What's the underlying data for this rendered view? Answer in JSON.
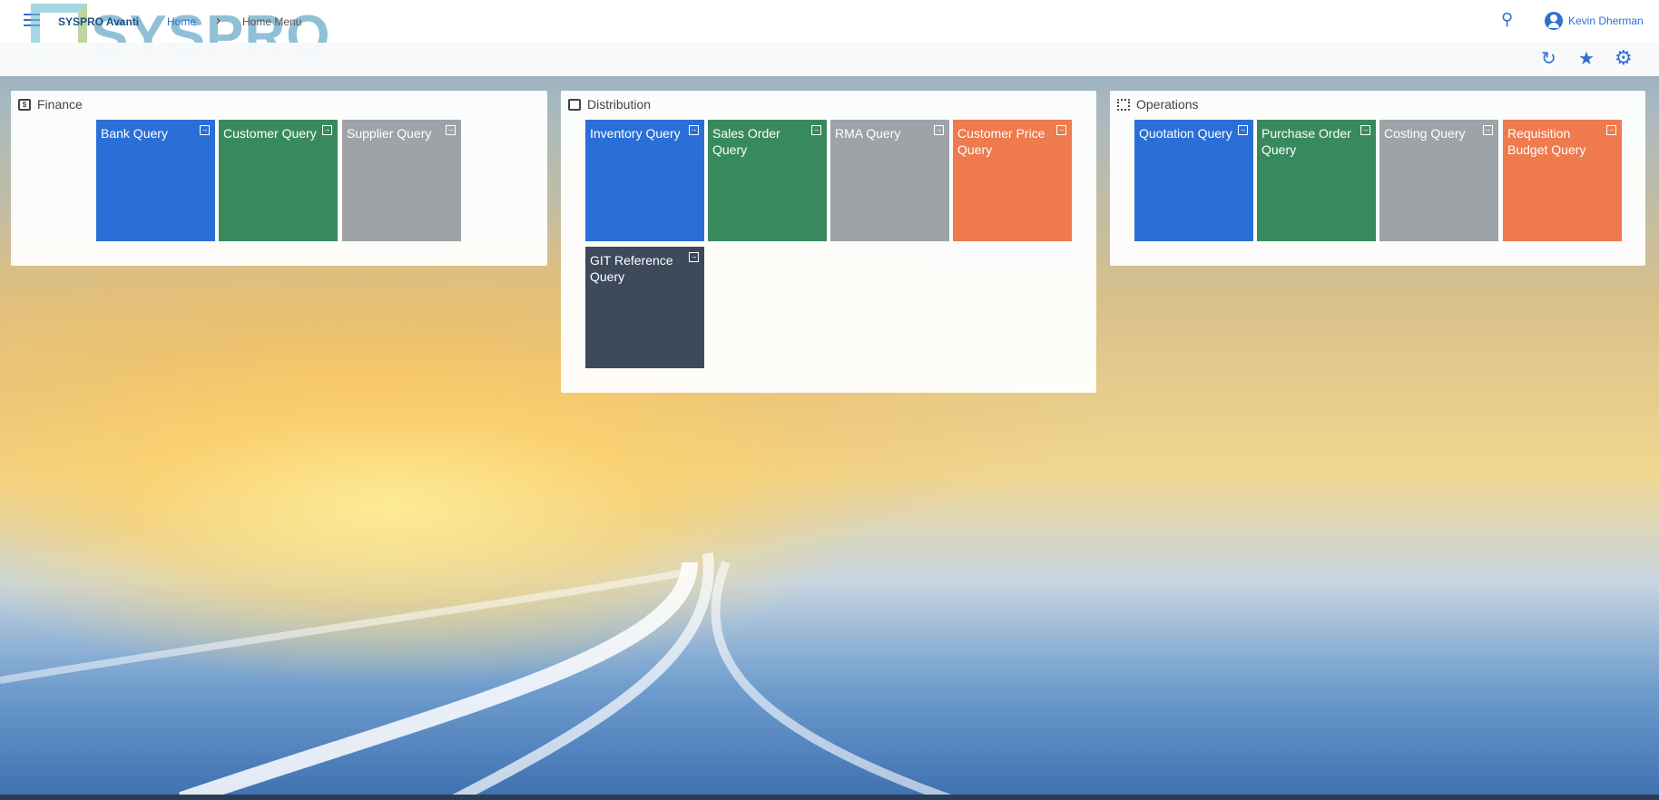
{
  "header": {
    "brand": "SYSPRO Avanti",
    "logo_text": "SYSPRO",
    "breadcrumb": [
      "Home",
      "Home Menu"
    ],
    "user": "Kevin Dherman"
  },
  "toolbar": {
    "icons": [
      "refresh-icon",
      "star-icon",
      "gear-icon"
    ]
  },
  "colors": {
    "blue": "#2a6fd8",
    "green": "#388a5e",
    "gray": "#9ea3a8",
    "orange": "#ee7a4e",
    "dark": "#3d4a5c",
    "accent": "#2f6fd0"
  },
  "panels": [
    {
      "title": "Finance",
      "tiles": [
        {
          "label": "Bank Query",
          "color": "blue"
        },
        {
          "label": "Customer Query",
          "color": "green"
        },
        {
          "label": "Supplier Query",
          "color": "gray"
        }
      ]
    },
    {
      "title": "Distribution",
      "tiles": [
        {
          "label": "Inventory Query",
          "color": "blue"
        },
        {
          "label": "Sales Order Query",
          "color": "green"
        },
        {
          "label": "RMA Query",
          "color": "gray"
        },
        {
          "label": "Customer Price Query",
          "color": "orange"
        },
        {
          "label": "GIT Reference Query",
          "color": "dark"
        }
      ]
    },
    {
      "title": "Operations",
      "tiles": [
        {
          "label": "Quotation Query",
          "color": "blue"
        },
        {
          "label": "Purchase Order Query",
          "color": "green"
        },
        {
          "label": "Costing Query",
          "color": "gray"
        },
        {
          "label": "Requisition Budget Query",
          "color": "orange"
        }
      ]
    }
  ]
}
